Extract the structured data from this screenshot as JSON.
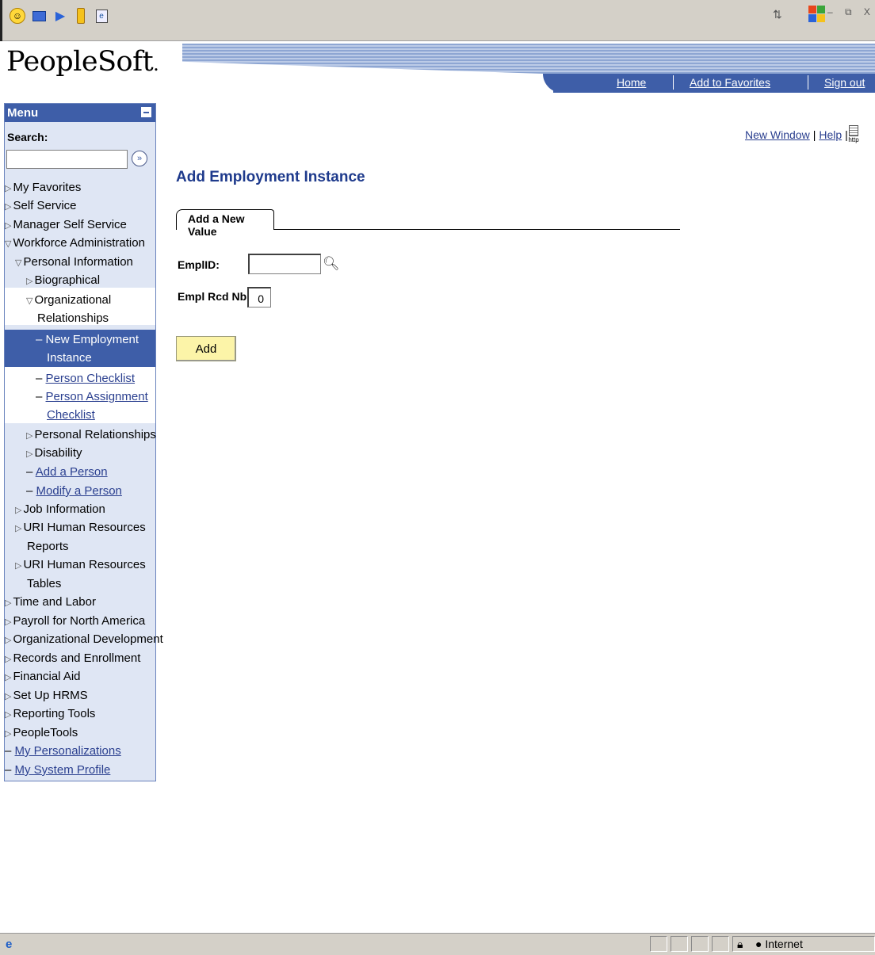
{
  "toolbar": {
    "icons": [
      "smiley-icon",
      "monitor-icon",
      "arrow-icon",
      "pencil-icon",
      "ie-page-icon"
    ],
    "window_controls": "- ̅ X"
  },
  "header": {
    "logo": "PeopleSoft",
    "logo_suffix": ".",
    "nav": {
      "home": "Home",
      "favorites": "Add to Favorites",
      "signout": "Sign out"
    }
  },
  "sidebar": {
    "menu_title": "Menu",
    "search_label": "Search:",
    "search_value": "",
    "items": [
      {
        "label": "My Favorites"
      },
      {
        "label": "Self Service"
      },
      {
        "label": "Manager Self Service"
      },
      {
        "label": "Workforce Administration"
      },
      {
        "label": "Personal Information"
      },
      {
        "label": "Biographical"
      },
      {
        "label": "Organizational"
      },
      {
        "label": "Relationships"
      },
      {
        "label": "New Employment"
      },
      {
        "label": "Instance"
      },
      {
        "label": "Person Checklist"
      },
      {
        "label": "Person Assignment"
      },
      {
        "label": "Checklist"
      },
      {
        "label": "Personal Relationships"
      },
      {
        "label": "Disability"
      },
      {
        "label": "Add a Person"
      },
      {
        "label": "Modify a Person"
      },
      {
        "label": "Job Information"
      },
      {
        "label": "URI Human Resources"
      },
      {
        "label": "Reports"
      },
      {
        "label": "URI Human Resources"
      },
      {
        "label": "Tables"
      },
      {
        "label": "Time and Labor"
      },
      {
        "label": "Payroll for North America"
      },
      {
        "label": "Organizational Development"
      },
      {
        "label": "Records and Enrollment"
      },
      {
        "label": "Financial Aid"
      },
      {
        "label": "Set Up HRMS"
      },
      {
        "label": "Reporting Tools"
      },
      {
        "label": "PeopleTools"
      },
      {
        "label": "My Personalizations"
      },
      {
        "label": "My System Profile"
      }
    ]
  },
  "main": {
    "new_window": "New Window",
    "help": "Help",
    "sep": "|",
    "http_label": "http",
    "title": "Add Employment Instance",
    "tab_label": "Add a New Value",
    "emplid_label": "EmplID:",
    "emplid_value": "",
    "rcd_label": "Empl Rcd Nbr:",
    "rcd_value": "0",
    "add_button": "Add"
  },
  "status": {
    "zone": "Internet"
  }
}
